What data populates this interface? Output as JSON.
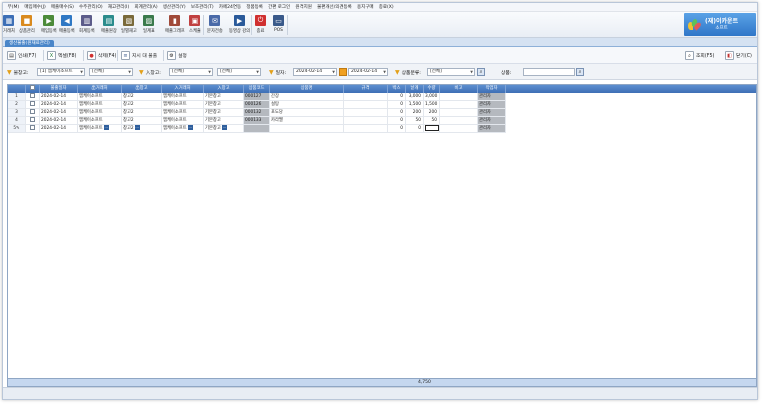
{
  "menu": [
    "무(M)",
    "매입매수(J)",
    "매출매수(S)",
    "수주관리(O)",
    "재고관리(I)",
    "회계관리(A)",
    "생산관리(Y)",
    "보조관리(T)",
    "카페24연동",
    "정품등록",
    "간편 로그인",
    "원격지원",
    "불편개선/의견등록",
    "용지구매",
    "종료(X)"
  ],
  "toolbar": [
    {
      "label": "거래처",
      "icon": "book-icon",
      "color": "#3d6fb6"
    },
    {
      "label": "상품관리",
      "icon": "box-icon",
      "color": "#d98a1e"
    },
    {
      "label": "매입등록",
      "icon": "truck-in-icon",
      "color": "#4c8b3a"
    },
    {
      "label": "매출등록",
      "icon": "truck-out-icon",
      "color": "#2f78c4"
    },
    {
      "label": "회계등록",
      "icon": "ledger-icon",
      "color": "#5c5c8a"
    },
    {
      "label": "매출원장",
      "icon": "report-icon",
      "color": "#2b8c8c"
    },
    {
      "label": "일별재고",
      "icon": "stock-icon",
      "color": "#7a6a3a"
    },
    {
      "label": "일계표",
      "icon": "table-icon",
      "color": "#3a7a4c"
    },
    {
      "label": "매출그래프",
      "icon": "chart-icon",
      "color": "#a04a3a"
    },
    {
      "label": "스케쥴",
      "icon": "calendar-icon",
      "color": "#c04040"
    },
    {
      "label": "문자전송",
      "icon": "message-icon",
      "color": "#4a6aa8"
    },
    {
      "label": "동영상 강의",
      "icon": "video-icon",
      "color": "#2a5a9a"
    },
    {
      "label": "종료",
      "icon": "power-icon",
      "color": "#d03030"
    },
    {
      "label": "POS",
      "icon": "pos-icon",
      "color": "#3a5a8a"
    }
  ],
  "brand": {
    "line1": "(재)이카운트",
    "line2": "소프트"
  },
  "tab": "생산불출(원재료관리)",
  "actions": {
    "print": "인쇄(F7)",
    "excel": "엑셀(F8)",
    "delete": "삭제(F4)",
    "instruction": "지시 대 불출",
    "settings": "설정",
    "search": "조회(F5)",
    "close": "닫기(C)"
  },
  "filters": {
    "out_wh_label": "불창고:",
    "out_wh_value": "[1] 엠케이소프트",
    "out_wh_sub": "[전체]",
    "in_wh_label": "入창고:",
    "in_wh_value": "[전체]",
    "in_wh_sub": "[전체]",
    "date_label": "일자:",
    "date_from": "2024-02-14",
    "date_to": "2024-02-14",
    "category_label": "상품분류:",
    "category_value": "[전체]",
    "product_label": "상품:",
    "product_value": ""
  },
  "table": {
    "columns": [
      "",
      "불출일자",
      "出거래처",
      "出창고",
      "入거래처",
      "入창고",
      "상품코드",
      "상품명",
      "규격",
      "박스",
      "낱개",
      "수량",
      "비고",
      "작업자"
    ],
    "rows": [
      {
        "n": "1",
        "date": "2024-02-14",
        "out_cust": "엠케이소프트",
        "out_wh": "창고2",
        "in_cust": "엠케이소프트",
        "in_wh": "기본창고",
        "code": "000127",
        "name": "간장",
        "spec": "",
        "box": "0",
        "pcs": "3,000",
        "qty": "3,000",
        "note": "",
        "worker": "관리자"
      },
      {
        "n": "2",
        "date": "2024-02-14",
        "out_cust": "엠케이소프트",
        "out_wh": "창고2",
        "in_cust": "엠케이소프트",
        "in_wh": "기본창고",
        "code": "000126",
        "name": "설탕",
        "spec": "",
        "box": "0",
        "pcs": "1,500",
        "qty": "1,500",
        "note": "",
        "worker": "관리자"
      },
      {
        "n": "3",
        "date": "2024-02-14",
        "out_cust": "엠케이소프트",
        "out_wh": "창고2",
        "in_cust": "엠케이소프트",
        "in_wh": "기본창고",
        "code": "000132",
        "name": "포도당",
        "spec": "",
        "box": "0",
        "pcs": "200",
        "qty": "200",
        "note": "",
        "worker": "관리자"
      },
      {
        "n": "4",
        "date": "2024-02-14",
        "out_cust": "엠케이소프트",
        "out_wh": "창고2",
        "in_cust": "엠케이소프트",
        "in_wh": "기본창고",
        "code": "000133",
        "name": "카라멜",
        "spec": "",
        "box": "0",
        "pcs": "50",
        "qty": "50",
        "note": "",
        "worker": "관리자"
      },
      {
        "n": "5✎",
        "date": "2024-02-14",
        "out_cust": "엠케이소프트",
        "out_wh": "창고2",
        "in_cust": "엠케이소프트",
        "in_wh": "기본창고",
        "code": "",
        "name": "",
        "spec": "",
        "box": "0",
        "pcs": "0",
        "qty": "",
        "note": "",
        "worker": "관리자"
      }
    ],
    "total_qty": "4,750"
  }
}
